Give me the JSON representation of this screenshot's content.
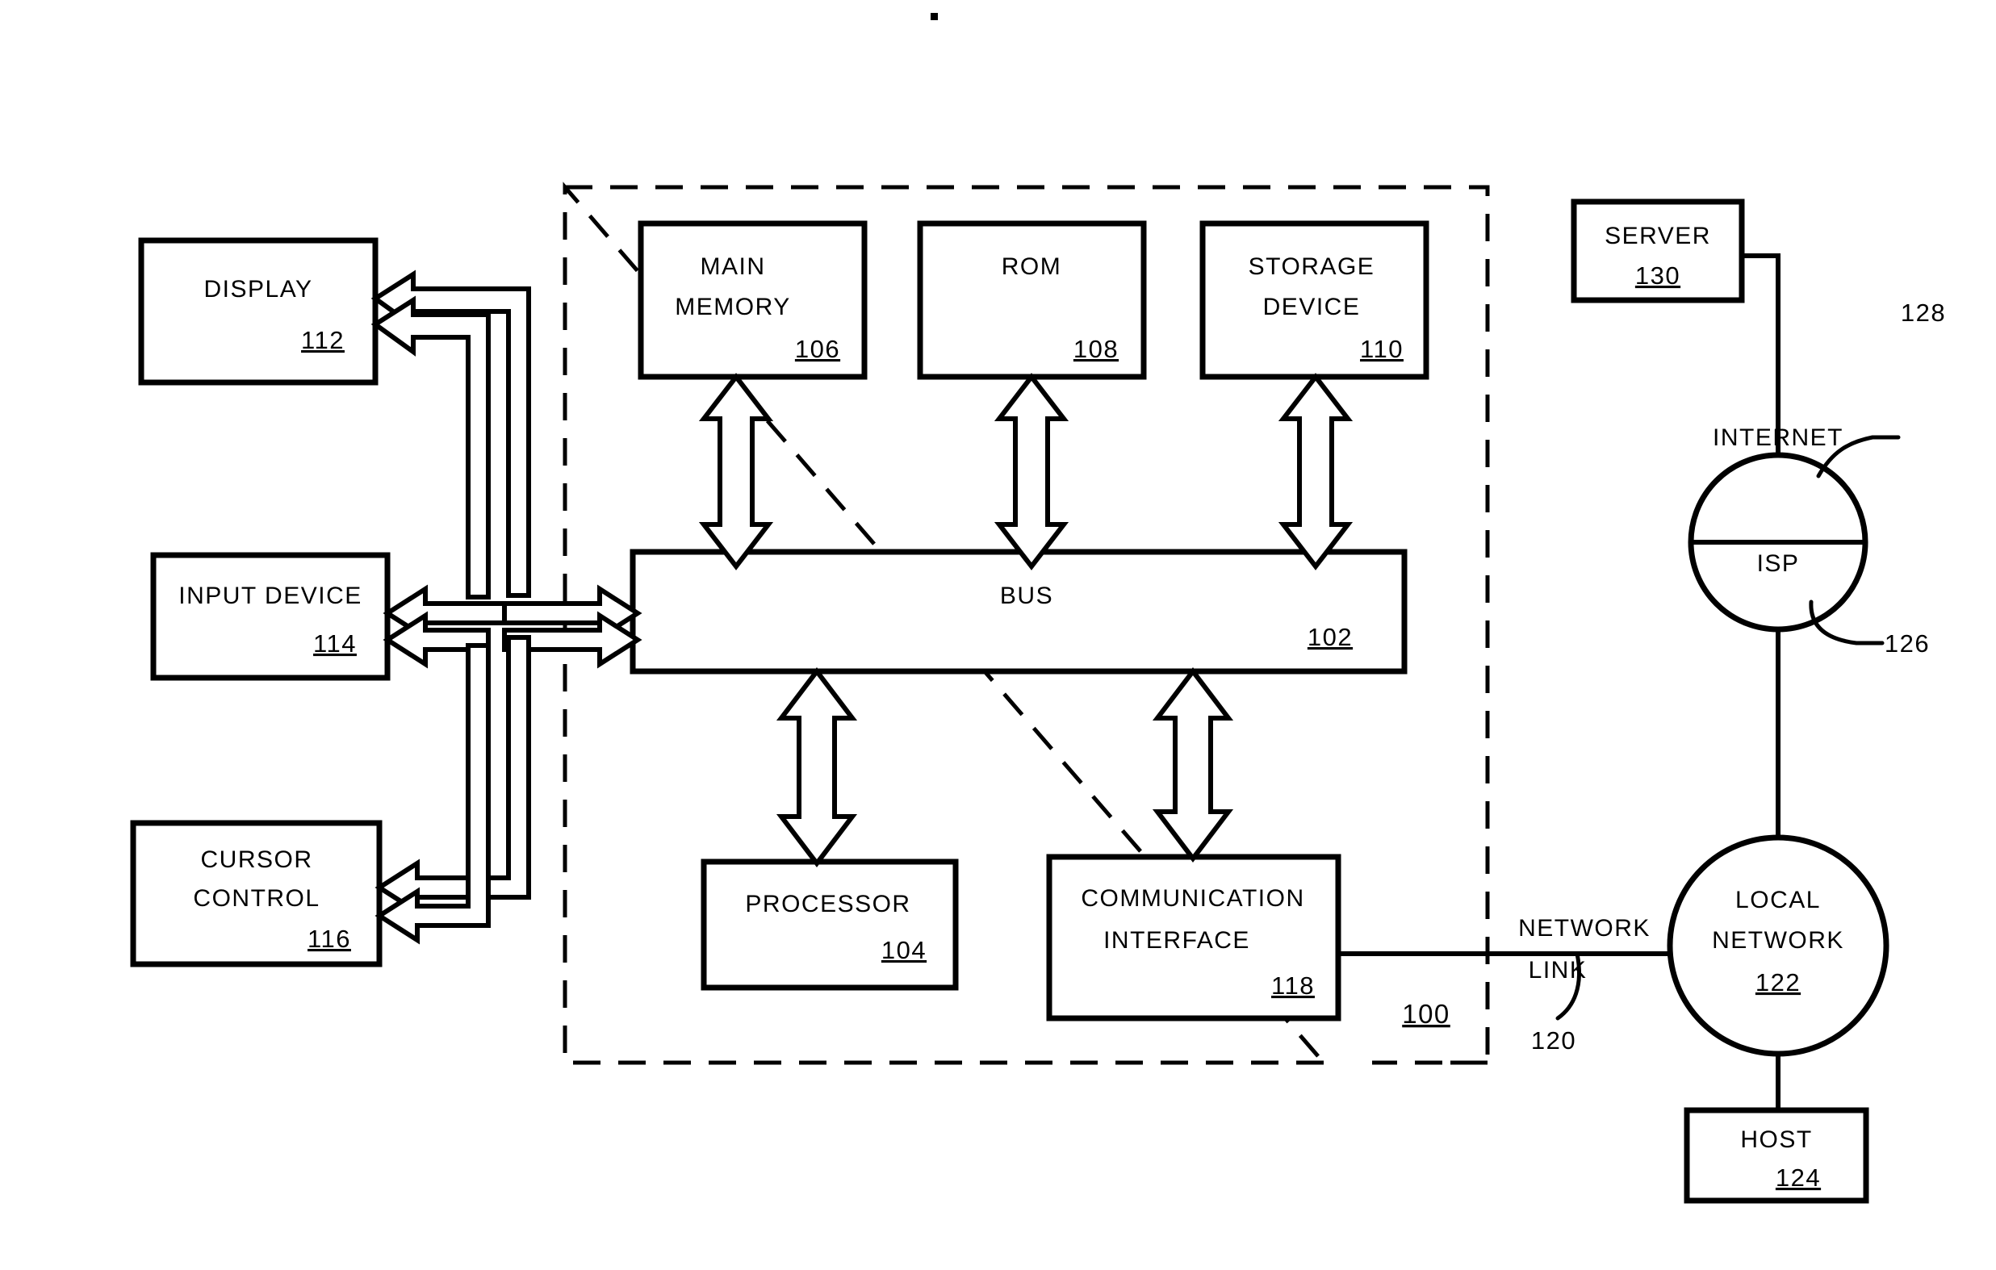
{
  "figure": {
    "title": "Computer system block diagram",
    "system_reference": "100",
    "stroke_color": "#000000",
    "background_color": "#ffffff"
  },
  "boundary": {
    "name": "computer-system-boundary",
    "style": "dashed",
    "reference": "100"
  },
  "peripherals": [
    {
      "id": "display",
      "lines": [
        "DISPLAY"
      ],
      "reference": "112"
    },
    {
      "id": "input-device",
      "lines": [
        "INPUT DEVICE"
      ],
      "reference": "114"
    },
    {
      "id": "cursor-control",
      "lines": [
        "CURSOR",
        "CONTROL"
      ],
      "reference": "116"
    }
  ],
  "memory_blocks": [
    {
      "id": "main-memory",
      "lines": [
        "MAIN",
        "MEMORY"
      ],
      "reference": "106"
    },
    {
      "id": "rom",
      "lines": [
        "ROM"
      ],
      "reference": "108"
    },
    {
      "id": "storage-device",
      "lines": [
        "STORAGE",
        "DEVICE"
      ],
      "reference": "110"
    }
  ],
  "bus": {
    "id": "bus",
    "label": "BUS",
    "reference": "102"
  },
  "lower_blocks": [
    {
      "id": "processor",
      "lines": [
        "PROCESSOR"
      ],
      "reference": "104"
    },
    {
      "id": "communication-interface",
      "lines": [
        "COMMUNICATION",
        "INTERFACE"
      ],
      "reference": "118"
    }
  ],
  "network": {
    "server": {
      "id": "server",
      "lines": [
        "SERVER"
      ],
      "reference": "130"
    },
    "internet_globe": {
      "id": "internet-isp-globe",
      "top_label": "INTERNET",
      "bottom_label": "ISP",
      "top_reference": "128",
      "bottom_reference": "126"
    },
    "local_network": {
      "id": "local-network",
      "lines": [
        "LOCAL",
        "NETWORK"
      ],
      "reference": "122"
    },
    "host": {
      "id": "host",
      "lines": [
        "HOST"
      ],
      "reference": "124"
    },
    "network_link": {
      "id": "network-link",
      "lines": [
        "NETWORK",
        "LINK"
      ],
      "reference": "120"
    }
  }
}
